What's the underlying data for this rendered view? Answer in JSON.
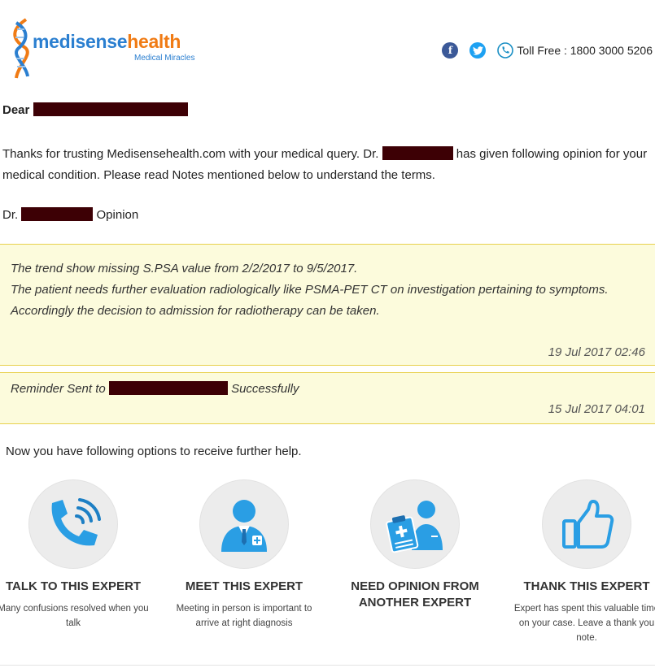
{
  "brand": {
    "name_part1": "medisense",
    "name_part2": "health",
    "tagline": "Medical Miracles"
  },
  "header": {
    "tollfree": "Toll Free : 1800 3000 5206",
    "icons": [
      "facebook-icon",
      "twitter-icon",
      "phone-icon"
    ]
  },
  "greeting": {
    "label": "Dear"
  },
  "intro": {
    "part1": "Thanks for trusting Medisensehealth.com with your medical query. Dr.",
    "part2": "has given following opinion for your medical condition. Please read Notes mentioned below to understand the terms."
  },
  "opinion_line": {
    "prefix": "Dr.",
    "suffix": "Opinion"
  },
  "opinion_note": {
    "lines": [
      "The trend show missing S.PSA value from 2/2/2017 to 9/5/2017.",
      "The patient needs further evaluation radiologically like PSMA-PET CT on investigation pertaining to symptoms.",
      "Accordingly the decision to admission for radiotherapy can be taken."
    ],
    "timestamp": "19 Jul 2017 02:46"
  },
  "reminder_note": {
    "prefix": "Reminder Sent to",
    "suffix": "Successfully",
    "timestamp": "15 Jul 2017 04:01"
  },
  "options_intro": "Now you have following options to receive further help.",
  "options": [
    {
      "title": "TALK TO THIS EXPERT",
      "desc": "Many confusions resolved when you talk",
      "icon": "phone-call-icon"
    },
    {
      "title": "MEET THIS EXPERT",
      "desc": "Meeting in person is important to arrive at right diagnosis",
      "icon": "doctor-icon"
    },
    {
      "title": "NEED OPINION FROM ANOTHER EXPERT",
      "desc": "",
      "icon": "clipboard-doctor-icon"
    },
    {
      "title": "THANK THIS EXPERT",
      "desc": "Expert has spent this valuable time on your case. Leave a thank you note.",
      "icon": "thumbs-up-icon"
    }
  ],
  "colors": {
    "accent_blue": "#2b7fd0",
    "accent_orange": "#f07b14",
    "note_bg": "#fcfbdc",
    "note_border": "#e8d04c",
    "redaction": "#3d0005"
  }
}
